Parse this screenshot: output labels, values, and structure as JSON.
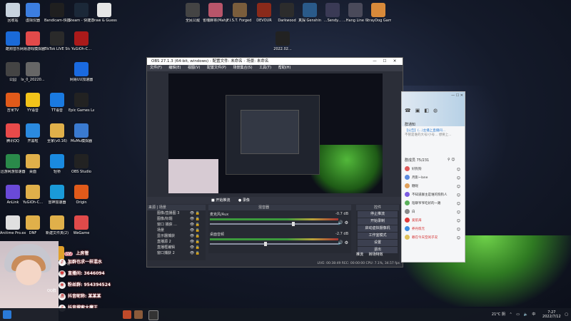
{
  "desktop_icons": [
    {
      "label": "回收站",
      "color": "#c8d3de"
    },
    {
      "label": "虚拟仪器",
      "color": "#3c7ee0"
    },
    {
      "label": "Bandicam-快捷方式",
      "color": "#1f1f1f"
    },
    {
      "label": "Steam - 快捷方式",
      "color": "#1b2838"
    },
    {
      "label": "Draw & Guess",
      "color": "#e6e6e6"
    },
    {
      "label": "全民公敌",
      "color": "#444"
    },
    {
      "label": "雀魂麻将(Mahjong...",
      "color": "#b8556a"
    },
    {
      "label": "F.I.S.T. Forged ...",
      "color": "#7a5d3c"
    },
    {
      "label": "DEVOUR",
      "color": "#8a2a1a"
    },
    {
      "label": "Darkwood",
      "color": "#2c2c2c"
    },
    {
      "label": "真探 Genshin",
      "color": "#2a5a8a"
    },
    {
      "label": "...Sendy...",
      "color": "#3a3a55"
    },
    {
      "label": "...Hang Line - 快捷方式",
      "color": "#4a4a5a"
    },
    {
      "label": "StrayDog Game",
      "color": "#d88a3a"
    },
    {
      "label": "酷狗音乐",
      "color": "#1a6ad8"
    },
    {
      "label": "网易游戏模拟器工具",
      "color": "#e24a4a"
    },
    {
      "label": "TikTok LIVE Studio",
      "color": "#2a2a2a"
    },
    {
      "label": "YuGiOh-C...",
      "color": "#aa1a1a"
    },
    {
      "label": "公园",
      "color": "#444"
    },
    {
      "label": "lx_0_20220...",
      "color": "#666"
    },
    {
      "label": "2022.02...",
      "color": "#222"
    },
    {
      "label": "网易UU加速器",
      "color": "#1a6ae0"
    },
    {
      "label": "吉米TV",
      "color": "#e05a1a"
    },
    {
      "label": "YY语音",
      "color": "#f2c31a"
    },
    {
      "label": "TT语音",
      "color": "#1a7ae0"
    },
    {
      "label": "Epic Games Launcher",
      "color": "#222"
    },
    {
      "label": "腾讯QQ",
      "color": "#e84a4a"
    },
    {
      "label": "开黑啦",
      "color": "#2a8ae0"
    },
    {
      "label": "全家(v0.16)",
      "color": "#e0b04a"
    },
    {
      "label": "MuMu模拟器",
      "color": "#3a7ad0"
    },
    {
      "label": "迅游网游加速器",
      "color": "#2a8a4a"
    },
    {
      "label": "桌面",
      "color": "#e0b04a"
    },
    {
      "label": "轻桥",
      "color": "#1a8ae0"
    },
    {
      "label": "OBS Studio",
      "color": "#222"
    },
    {
      "label": "AnLink",
      "color": "#6a4ad8"
    },
    {
      "label": "YuGiOh-C...",
      "color": "#e0b04a"
    },
    {
      "label": "雷神加速器",
      "color": "#1a9ad8"
    },
    {
      "label": "Origin",
      "color": "#e05a1a"
    },
    {
      "label": "Arctime Pro.exe - 快捷方式",
      "color": "#e0e0e0"
    },
    {
      "label": "DNF",
      "color": "#e0b04a"
    },
    {
      "label": "新建文件夹(2)",
      "color": "#e0b04a"
    },
    {
      "label": "WeGame",
      "color": "#e04a4a"
    },
    {
      "label": "迅捷文字转语音",
      "color": "#2a8ad8"
    },
    {
      "label": "迅飞语音",
      "color": "#3a6ae0"
    },
    {
      "label": "欢乐斗地主(手游模拟器)",
      "color": "#e0a02a"
    }
  ],
  "obs": {
    "title": "OBS 27.1.3 (64-bit, windows) - 配置文件: 未命名 - 场景: 未命名",
    "title_controls": [
      "—",
      "☐",
      "✕"
    ],
    "menu": [
      "文件(F)",
      "编辑(E)",
      "视图(V)",
      "配置文件(P)",
      "场景集合(S)",
      "工具(T)",
      "帮助(H)"
    ],
    "preview_bar": [
      "■ 开始推流",
      "● 录像"
    ],
    "panels": {
      "sources": "来源 | 场景",
      "mixer": "混音器",
      "controls": "控件"
    },
    "sources": [
      "图像/直播图 3",
      "图像/标题",
      "窗口 捕获 ...",
      "场景",
      "显示器捕获",
      "直播源 2",
      "直播框编辑",
      "窗口捕获 2"
    ],
    "tracks": [
      {
        "name": "麦克风/Aux",
        "db": "-0.7 dB",
        "level": 0.64
      },
      {
        "name": "桌面音频",
        "db": "-2.7 dB",
        "level": 0.42
      }
    ],
    "control_buttons": [
      "停止推流",
      "开始录制",
      "启动虚拟摄像机",
      "工作室模式",
      "设置",
      "退出"
    ],
    "control_footer": [
      "推流",
      "转场特效"
    ],
    "status": "LIVE: 00:38:49   REC: 00:00:00   CPU: 7.1%, 34.57 fps"
  },
  "chat": {
    "title_controls": [
      "—",
      "☐",
      "✕"
    ],
    "icons": [
      "☎",
      "▣",
      "◧",
      "◍"
    ],
    "notice_title": "群通知",
    "notice_lines": [
      "【公告】(...)主播上直播间...",
      "不管是谁的大号/小号... 想要上..."
    ],
    "members_label": "群成员 75/231",
    "member_icons": "⚲ ☺",
    "members": [
      {
        "name": "好狗狗",
        "color": "#e05a5a",
        "name_color": "#333"
      },
      {
        "name": "月影~lane",
        "color": "#5a8ae0",
        "name_color": "#333"
      },
      {
        "name": "糖呢",
        "color": "#e0a05a",
        "name_color": "#333"
      },
      {
        "name": "不知道群主是谁的狗狗人",
        "color": "#7a5ae0",
        "name_color": "#333"
      },
      {
        "name": "陪聊爷爷吃好的一路",
        "color": "#5ab05a",
        "name_color": "#333"
      },
      {
        "name": "白",
        "color": "#888",
        "name_color": "#333"
      },
      {
        "name": "爱航海",
        "color": "#e03a3a",
        "name_color": "#d42a2a"
      },
      {
        "name": "养丹炼元",
        "color": "#3a8ae0",
        "name_color": "#d42a2a"
      },
      {
        "name": "赖在今天空闲子况",
        "color": "#e0c05a",
        "name_color": "#d42a2a"
      }
    ]
  },
  "streamer_info": {
    "header": "上房管",
    "lines": [
      {
        "icon": "♪",
        "text": "加群也求一样混水"
      },
      {
        "icon": "♥",
        "text": "直播间: 3646094"
      },
      {
        "icon": "★",
        "text": "粉丝群: 954394524"
      },
      {
        "icon": "♬",
        "text": "抖音昵称: 某某某"
      },
      {
        "icon": "♪",
        "text": "抖音搜索大魔王"
      }
    ],
    "badge": "QQ群"
  },
  "taskbar": {
    "weather": "21°C 阴",
    "lang": "中",
    "time": "7:27",
    "date": "2022/7/12"
  }
}
